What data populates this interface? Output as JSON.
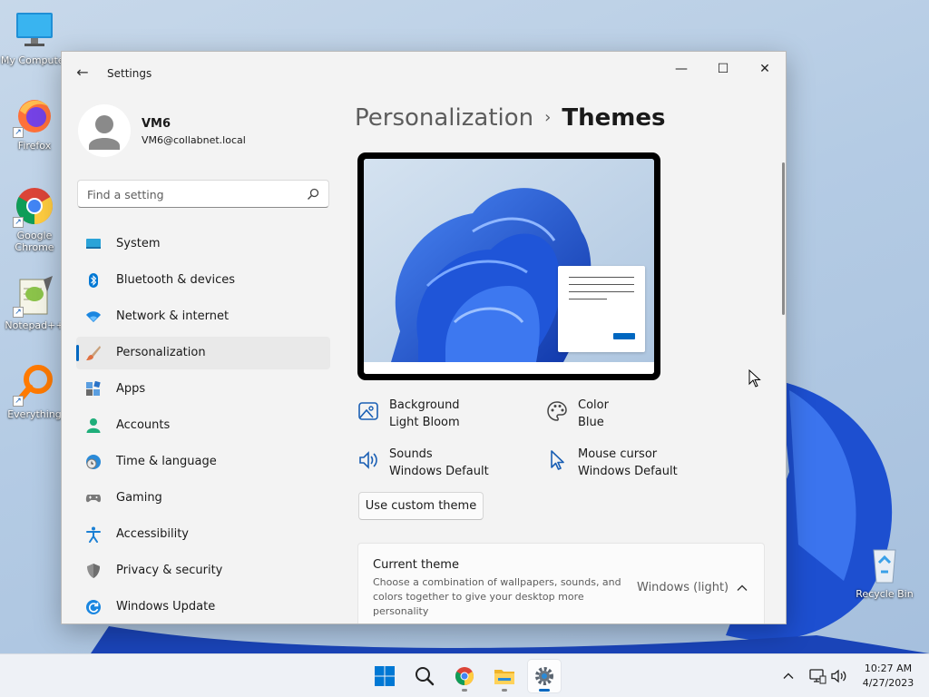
{
  "desktop": {
    "icons": [
      {
        "label": "My Computer"
      },
      {
        "label": "Firefox"
      },
      {
        "label": "Google Chrome"
      },
      {
        "label": "Notepad++"
      },
      {
        "label": "Everything"
      },
      {
        "label": "Recycle Bin"
      }
    ]
  },
  "window": {
    "title": "Settings",
    "back_icon": "back-arrow-icon",
    "controls": {
      "minimize": "—",
      "maximize": "☐",
      "close": "✕"
    }
  },
  "profile": {
    "name": "VM6",
    "email": "VM6@collabnet.local"
  },
  "search": {
    "placeholder": "Find a setting"
  },
  "nav": {
    "items": [
      {
        "label": "System",
        "icon": "system-icon"
      },
      {
        "label": "Bluetooth & devices",
        "icon": "bluetooth-icon"
      },
      {
        "label": "Network & internet",
        "icon": "wifi-icon"
      },
      {
        "label": "Personalization",
        "icon": "brush-icon",
        "active": true
      },
      {
        "label": "Apps",
        "icon": "apps-icon"
      },
      {
        "label": "Accounts",
        "icon": "accounts-icon"
      },
      {
        "label": "Time & language",
        "icon": "clock-globe-icon"
      },
      {
        "label": "Gaming",
        "icon": "gamepad-icon"
      },
      {
        "label": "Accessibility",
        "icon": "accessibility-icon"
      },
      {
        "label": "Privacy & security",
        "icon": "shield-icon"
      },
      {
        "label": "Windows Update",
        "icon": "update-icon"
      }
    ]
  },
  "main": {
    "breadcrumb": {
      "parent": "Personalization",
      "separator": "›",
      "current": "Themes"
    },
    "properties": [
      {
        "title": "Background",
        "value": "Light Bloom",
        "icon": "image-icon"
      },
      {
        "title": "Color",
        "value": "Blue",
        "icon": "palette-icon"
      },
      {
        "title": "Sounds",
        "value": "Windows Default",
        "icon": "speaker-icon"
      },
      {
        "title": "Mouse cursor",
        "value": "Windows Default",
        "icon": "cursor-icon"
      }
    ],
    "custom_theme_button": "Use custom theme",
    "current_theme": {
      "title": "Current theme",
      "description": "Choose a combination of wallpapers, sounds, and colors together to give your desktop more personality",
      "value": "Windows (light)"
    }
  },
  "taskbar": {
    "clock": {
      "time": "10:27 AM",
      "date": "4/27/2023"
    }
  },
  "colors": {
    "accent": "#0067c0",
    "window_bg": "#f3f3f3",
    "bloom": "#1f55d8"
  }
}
